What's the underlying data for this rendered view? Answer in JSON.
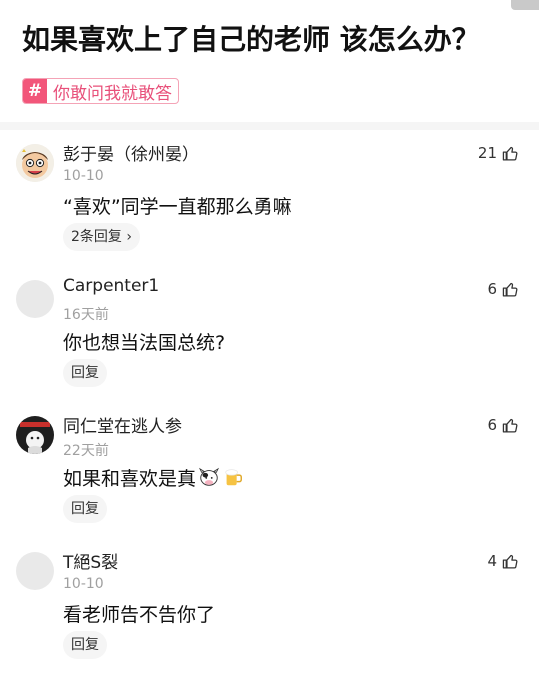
{
  "question": {
    "title": "如果喜欢上了自己的老师 该怎么办？",
    "topic_tag": "你敢问我就敢答"
  },
  "icons": {
    "hash": "hash-icon",
    "like": "thumbs-up-icon",
    "reply_chevron": "chevron-right-icon"
  },
  "colors": {
    "accent": "#f2567a",
    "accent_text": "#e8507a",
    "muted_text": "#a0a0a0"
  },
  "comments": [
    {
      "username": "彭于晏（徐州晏）",
      "time": "10-10",
      "content": "“喜欢”同学一直都那么勇嘛",
      "likes": "21",
      "reply_label": "2条回复",
      "avatar": "cartoon-face-avatar"
    },
    {
      "username": "Carpenter1",
      "time": "16天前",
      "content": "你也想当法国总统?",
      "likes": "6",
      "reply_label": "回复",
      "avatar": "default-gray-avatar"
    },
    {
      "username": "同仁堂在逃人参",
      "time": "22天前",
      "content": "如果和喜欢是真",
      "content_emojis": [
        "cow-emoji",
        "beer-emoji"
      ],
      "likes": "6",
      "reply_label": "回复",
      "avatar": "dark-character-avatar"
    },
    {
      "username": "T絕S裂",
      "time": "10-10",
      "content": "看老师告不告你了",
      "likes": "4",
      "reply_label": "回复",
      "avatar": "default-gray-avatar"
    }
  ]
}
